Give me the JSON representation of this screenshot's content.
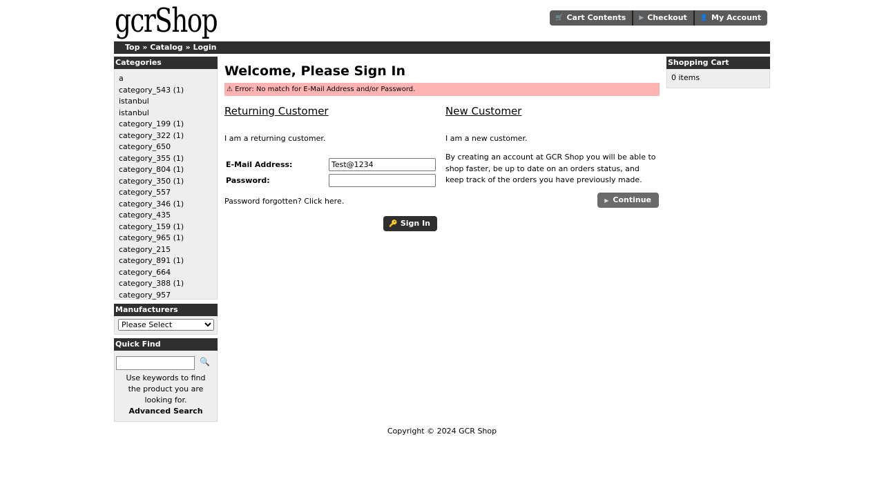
{
  "header": {
    "logo": "gcrShop",
    "buttons": [
      {
        "label": "Cart Contents",
        "icon": "cart-icon"
      },
      {
        "label": "Checkout",
        "icon": "arrow-right-icon"
      },
      {
        "label": "My Account",
        "icon": "person-icon"
      }
    ]
  },
  "breadcrumb": {
    "items": [
      "Top",
      "Catalog",
      "Login"
    ],
    "separator": "»"
  },
  "categories": {
    "title": "Categories",
    "items": [
      "a",
      "category_543 (1)",
      "istanbul",
      "istanbul",
      "category_199 (1)",
      "category_322 (1)",
      "category_650",
      "category_355 (1)",
      "category_804 (1)",
      "category_350 (1)",
      "category_557",
      "category_346 (1)",
      "category_435",
      "category_159 (1)",
      "category_965 (1)",
      "category_215",
      "category_891 (1)",
      "category_664",
      "category_388 (1)",
      "category_957"
    ]
  },
  "manufacturers": {
    "title": "Manufacturers",
    "selected": "Please Select"
  },
  "quick_find": {
    "title": "Quick Find",
    "value": "",
    "help": "Use keywords to find the product you are looking for.",
    "advanced": "Advanced Search"
  },
  "main": {
    "title": "Welcome, Please Sign In",
    "error_icon": "⚠",
    "error": "Error: No match for E-Mail Address and/or Password.",
    "returning": {
      "heading": "Returning Customer",
      "text": "I am a returning customer.",
      "email_label": "E-Mail Address:",
      "email_value": "Test@1234",
      "password_label": "Password:",
      "password_value": "",
      "forgot_text": "Password forgotten? ",
      "forgot_link": "Click here.",
      "signin_label": "Sign In"
    },
    "new": {
      "heading": "New Customer",
      "text1": "I am a new customer.",
      "text2": "By creating an account at GCR Shop you will be able to shop faster, be up to date on an orders status, and keep track of the orders you have previously made.",
      "continue_label": "Continue"
    }
  },
  "cart": {
    "title": "Shopping Cart",
    "summary": "0 items"
  },
  "footer": {
    "copyright": "Copyright © 2024 GCR Shop"
  }
}
